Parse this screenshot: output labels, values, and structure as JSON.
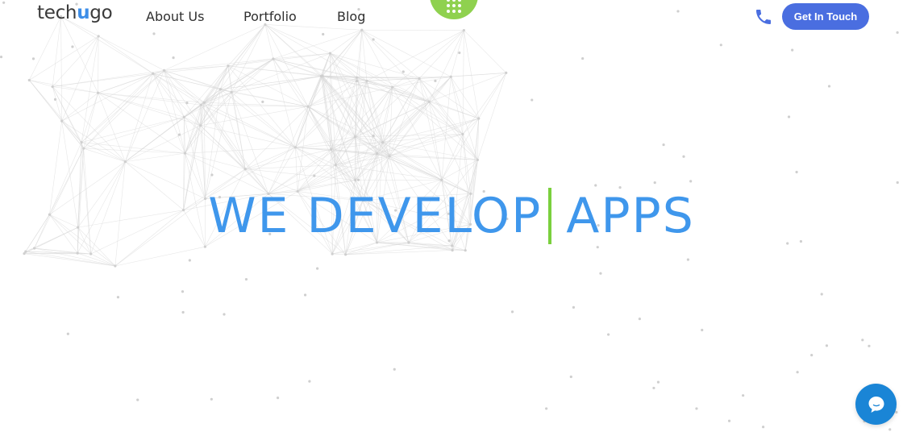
{
  "header": {
    "logo": {
      "prefix": "tech",
      "highlight": "u",
      "suffix": "go"
    },
    "nav": [
      {
        "label": "About Us"
      },
      {
        "label": "Portfolio"
      },
      {
        "label": "Blog"
      }
    ],
    "menu_icon": "grid-dots-icon",
    "phone_icon": "phone-icon",
    "cta_label": "Get In Touch"
  },
  "hero": {
    "text_before": "WE DEVELOP",
    "text_after": "APPS"
  },
  "chat_icon": "chat-bubble-icon",
  "colors": {
    "brand_blue": "#3f97ec",
    "cta_blue": "#4a6ee0",
    "accent_green": "#8fd14f",
    "cursor_green": "#7ad03d",
    "chat_blue": "#1a85d6"
  }
}
